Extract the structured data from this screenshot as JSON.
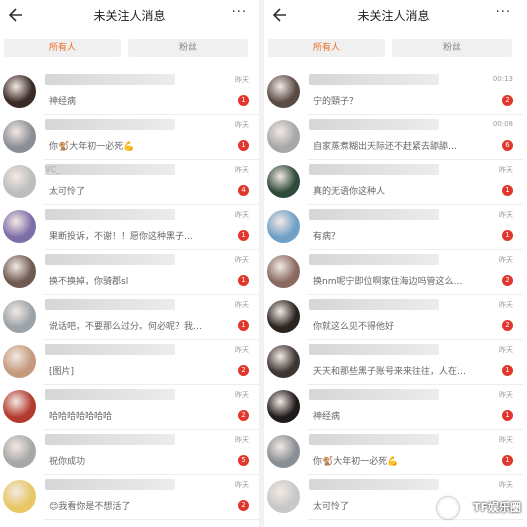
{
  "left": {
    "header": {
      "title": "未关注人消息",
      "more": "···"
    },
    "tabs": [
      {
        "label": "所有人",
        "active": true
      },
      {
        "label": "粉丝",
        "active": false
      }
    ],
    "messages": [
      {
        "name": "",
        "preview": "神经病",
        "time": "昨天",
        "badge": "1",
        "avatar_color": "#3a2a26"
      },
      {
        "name": "",
        "preview": "你🐒大年初一必死💪",
        "time": "昨天",
        "badge": "1",
        "avatar_color": "#8a8f95"
      },
      {
        "name": "VC_",
        "preview": "太可怜了",
        "time": "昨天",
        "badge": "4",
        "avatar_color": "#bdbdbd"
      },
      {
        "name": "",
        "preview": "果断投诉，不谢！！愿你这种黑子…",
        "time": "昨天",
        "badge": "1",
        "avatar_color": "#7d6ea8"
      },
      {
        "name": "",
        "preview": "换不换掉，你骑郡sl",
        "time": "昨天",
        "badge": "1",
        "avatar_color": "#6f5a52"
      },
      {
        "name": "",
        "preview": "说话吧，不要那么过分。何必呢？我…",
        "time": "昨天",
        "badge": "1",
        "avatar_color": "#9aa3a8"
      },
      {
        "name": "",
        "preview": "[图片]",
        "time": "昨天",
        "badge": "2",
        "avatar_color": "#c49a7c"
      },
      {
        "name": "",
        "preview": "哈哈哈哈哈哈哈",
        "time": "昨天",
        "badge": "2",
        "avatar_color": "#b23a2e"
      },
      {
        "name": "",
        "preview": "祝你成功",
        "time": "昨天",
        "badge": "5",
        "avatar_color": "#a7a7a7"
      },
      {
        "name": "",
        "preview": "😊我看你是不想活了",
        "time": "昨天",
        "badge": "2",
        "avatar_color": "#e7c766"
      }
    ]
  },
  "right": {
    "header": {
      "title": "未关注人消息",
      "more": "···"
    },
    "tabs": [
      {
        "label": "所有人",
        "active": true
      },
      {
        "label": "粉丝",
        "active": false
      }
    ],
    "messages": [
      {
        "name": "",
        "preview": "宁的頸子？",
        "time": "00:13",
        "badge": "2",
        "avatar_color": "#5a4a44"
      },
      {
        "name": "",
        "preview": "自家蒸煮糊出天际还不赶紧去舔舔…",
        "time": "00:08",
        "badge": "6",
        "avatar_color": "#a8a8a8"
      },
      {
        "name": "",
        "preview": "真的无语你这种人",
        "time": "昨天",
        "badge": "1",
        "avatar_color": "#2e4a3a"
      },
      {
        "name": "",
        "preview": "有病？",
        "time": "昨天",
        "badge": "1",
        "avatar_color": "#6fa0c8"
      },
      {
        "name": "",
        "preview": "换nm呢宁即位啊家住海边吗管这么…",
        "time": "昨天",
        "badge": "2",
        "avatar_color": "#8a6a60"
      },
      {
        "name": "",
        "preview": "你就这么见不得他好",
        "time": "昨天",
        "badge": "2",
        "avatar_color": "#2a2320"
      },
      {
        "name": "",
        "preview": "天天和那些黑子账号来来往往，人在…",
        "time": "昨天",
        "badge": "1",
        "avatar_color": "#3d3633"
      },
      {
        "name": "",
        "preview": "神经病",
        "time": "昨天",
        "badge": "1",
        "avatar_color": "#1f1b1a"
      },
      {
        "name": "",
        "preview": "你🐒大年初一必死💪",
        "time": "昨天",
        "badge": "1",
        "avatar_color": "#8a8f95"
      },
      {
        "name": "",
        "preview": "太可怜了",
        "time": "昨天",
        "badge": "",
        "avatar_color": "#c8c8c8"
      }
    ]
  },
  "watermark": "TF娱乐圈",
  "colors": {
    "accent": "#ec6a1f",
    "badge": "#e0362c"
  }
}
